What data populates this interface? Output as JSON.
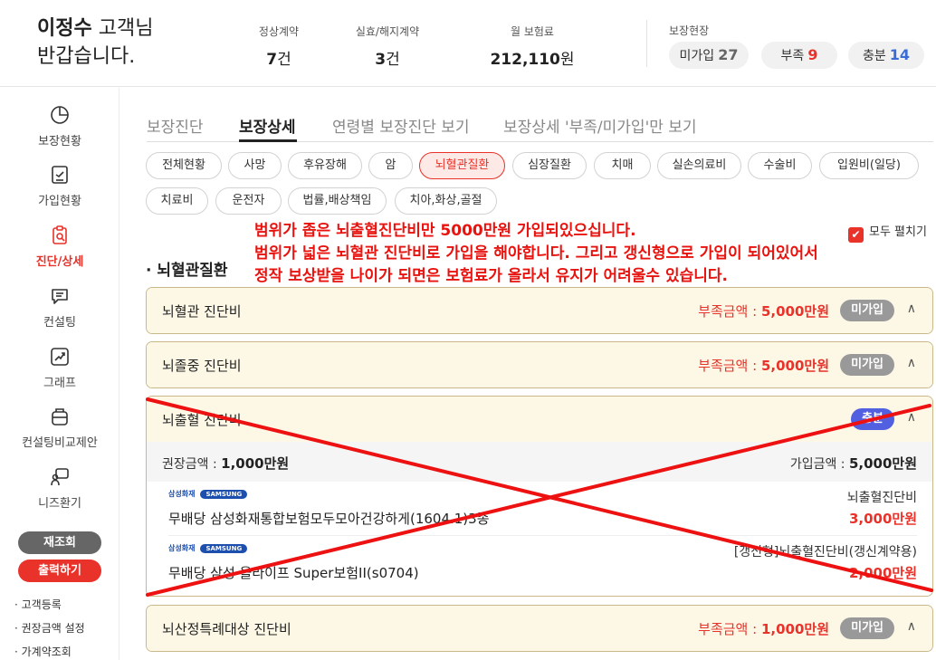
{
  "header": {
    "customer_name": "이정수",
    "honorific": " 고객님",
    "greeting": "반갑습니다.",
    "stats": [
      {
        "label": "정상계약",
        "value": "7",
        "unit": "건"
      },
      {
        "label": "실효/해지계약",
        "value": "3",
        "unit": "건"
      },
      {
        "label": "월 보험료",
        "value": "212,110",
        "unit": "원"
      }
    ],
    "coverage_status_title": "보장현장",
    "coverage_pills": [
      {
        "label": "미가입",
        "count": "27",
        "color": "#666666"
      },
      {
        "label": "부족",
        "count": "9",
        "color": "#e8322a"
      },
      {
        "label": "충분",
        "count": "14",
        "color": "#3b6bd6"
      }
    ]
  },
  "sidebar": {
    "items": [
      {
        "label": "보장현황",
        "icon": "pie-chart-icon"
      },
      {
        "label": "가입현황",
        "icon": "document-icon"
      },
      {
        "label": "진단/상세",
        "icon": "clipboard-search-icon",
        "active": true
      },
      {
        "label": "컨설팅",
        "icon": "chat-icon"
      },
      {
        "label": "그래프",
        "icon": "graph-icon"
      },
      {
        "label": "컨설팅비교제안",
        "icon": "compare-icon"
      },
      {
        "label": "니즈환기",
        "icon": "presenter-icon"
      }
    ],
    "refresh_button": "재조회",
    "print_button": "출력하기",
    "links": [
      "· 고객등록",
      "· 권장금액 설정",
      "· 가계약조회"
    ]
  },
  "tabs": [
    "보장진단",
    "보장상세",
    "연령별 보장진단 보기",
    "보장상세 '부족/미가입'만 보기"
  ],
  "active_tab": "보장상세",
  "categories": [
    "전체현황",
    "사망",
    "후유장해",
    "암",
    "뇌혈관질환",
    "심장질환",
    "치매",
    "실손의료비",
    "수술비",
    "입원비(일당)",
    "치료비",
    "운전자",
    "법률,배상책임",
    "치아,화상,골절"
  ],
  "active_category": "뇌혈관질환",
  "annotation": [
    "범위가 좁은 뇌출혈진단비만 5000만원 가입되있으십니다.",
    "범위가 넓은 뇌혈관 진단비로 가입을 해야합니다. 그리고 갱신형으로 가입이 되어있어서",
    "정작 보상받을 나이가 되면은 보험료가 올라서 유지가 어려울수 있습니다."
  ],
  "expand_all_label": "모두 펼치기",
  "section_title": "· 뇌혈관질환",
  "cards": [
    {
      "title": "뇌혈관 진단비",
      "shortage_label": "부족금액 : ",
      "shortage_amount": "5,000만원",
      "badge": "미가입"
    },
    {
      "title": "뇌졸중 진단비",
      "shortage_label": "부족금액 : ",
      "shortage_amount": "5,000만원",
      "badge": "미가입"
    },
    {
      "title": "뇌출혈 진단비",
      "badge": "충분",
      "recommended_label": "권장금액 : ",
      "recommended_amount": "1,000만원",
      "joined_label": "가입금액 : ",
      "joined_amount": "5,000만원",
      "plans": [
        {
          "insurer": "삼성화재",
          "brand": "SAMSUNG",
          "name": "무배당 삼성화재통합보험모두모아건강하게(1604.1)3종",
          "coverage": "뇌출혈진단비",
          "amount": "3,000만원"
        },
        {
          "insurer": "삼성화재",
          "brand": "SAMSUNG",
          "name": "무배당 삼성 올라이프 Super보험II(s0704)",
          "coverage": "[갱신형]뇌출혈진단비(갱신계약용)",
          "amount": "2,000만원"
        }
      ]
    },
    {
      "title": "뇌산정특례대상 진단비",
      "shortage_label": "부족금액 : ",
      "shortage_amount": "1,000만원",
      "badge": "미가입"
    }
  ],
  "colors": {
    "accent": "#e8322a",
    "card_header": "#fdf8e6",
    "sufficient_badge": "#5160e0",
    "annotation": "#e8130f"
  }
}
